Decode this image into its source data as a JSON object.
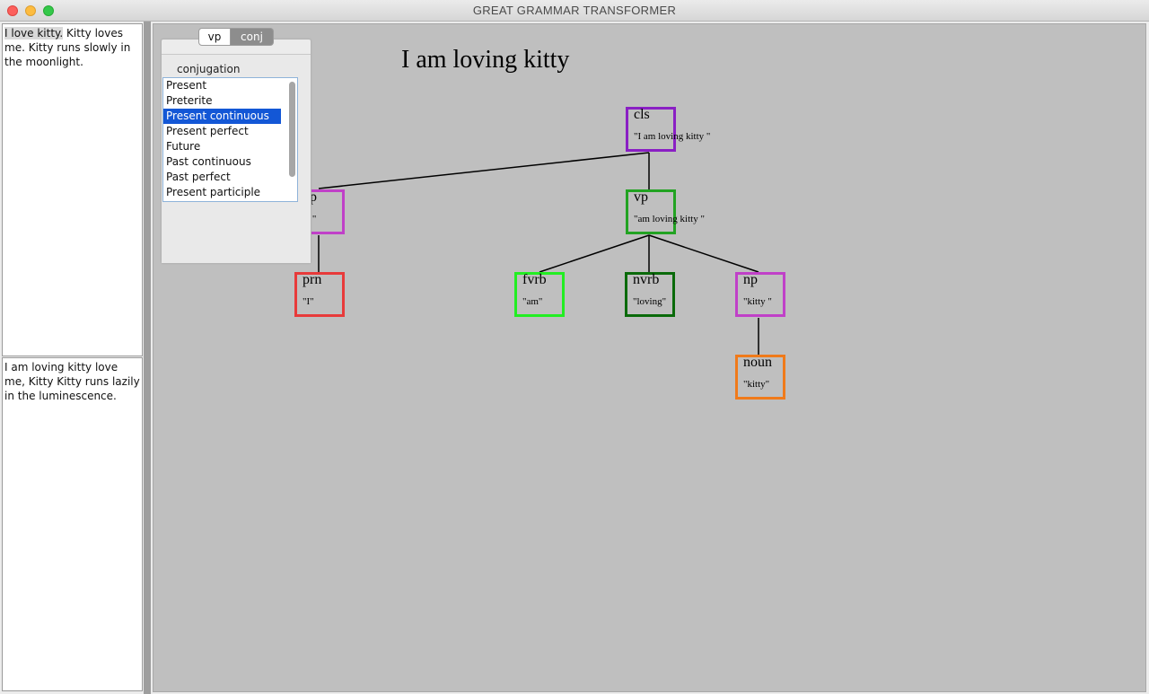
{
  "window": {
    "title": "GREAT GRAMMAR TRANSFORMER"
  },
  "left_panes": {
    "input_highlight": "I love kitty.",
    "input_rest": " Kitty loves me. Kitty runs slowly in the moonlight.",
    "output_text": "I am loving kitty love me, Kitty Kitty runs lazily in the luminescence."
  },
  "panel": {
    "tabs": [
      {
        "label": "vp",
        "selected": false
      },
      {
        "label": "conj",
        "selected": true
      }
    ],
    "section_label": "conjugation",
    "conjugations": [
      "Present",
      "Preterite",
      "Present continuous",
      "Present perfect",
      "Future",
      "Past continuous",
      "Past perfect",
      "Present participle"
    ],
    "selected_conjugation": "Present continuous"
  },
  "canvas": {
    "sentence": "I am loving kitty",
    "nodes": {
      "cls": {
        "label": "cls",
        "value": "\"I am loving kitty \"",
        "color": "#8a1fc4"
      },
      "np": {
        "label": "np",
        "value": "\"I \"",
        "color": "#c040c8"
      },
      "vp": {
        "label": "vp",
        "value": "\"am loving kitty \"",
        "color": "#22a322"
      },
      "prn": {
        "label": "prn",
        "value": "\"I\"",
        "color": "#e83a3a"
      },
      "fvrb": {
        "label": "fvrb",
        "value": "\"am\"",
        "color": "#22ee22"
      },
      "nvrb": {
        "label": "nvrb",
        "value": "\"loving\"",
        "color": "#0a6a0a"
      },
      "np2": {
        "label": "np",
        "value": "\"kitty \"",
        "color": "#c040c8"
      },
      "noun": {
        "label": "noun",
        "value": "\"kitty\"",
        "color": "#f07a1a"
      }
    }
  }
}
